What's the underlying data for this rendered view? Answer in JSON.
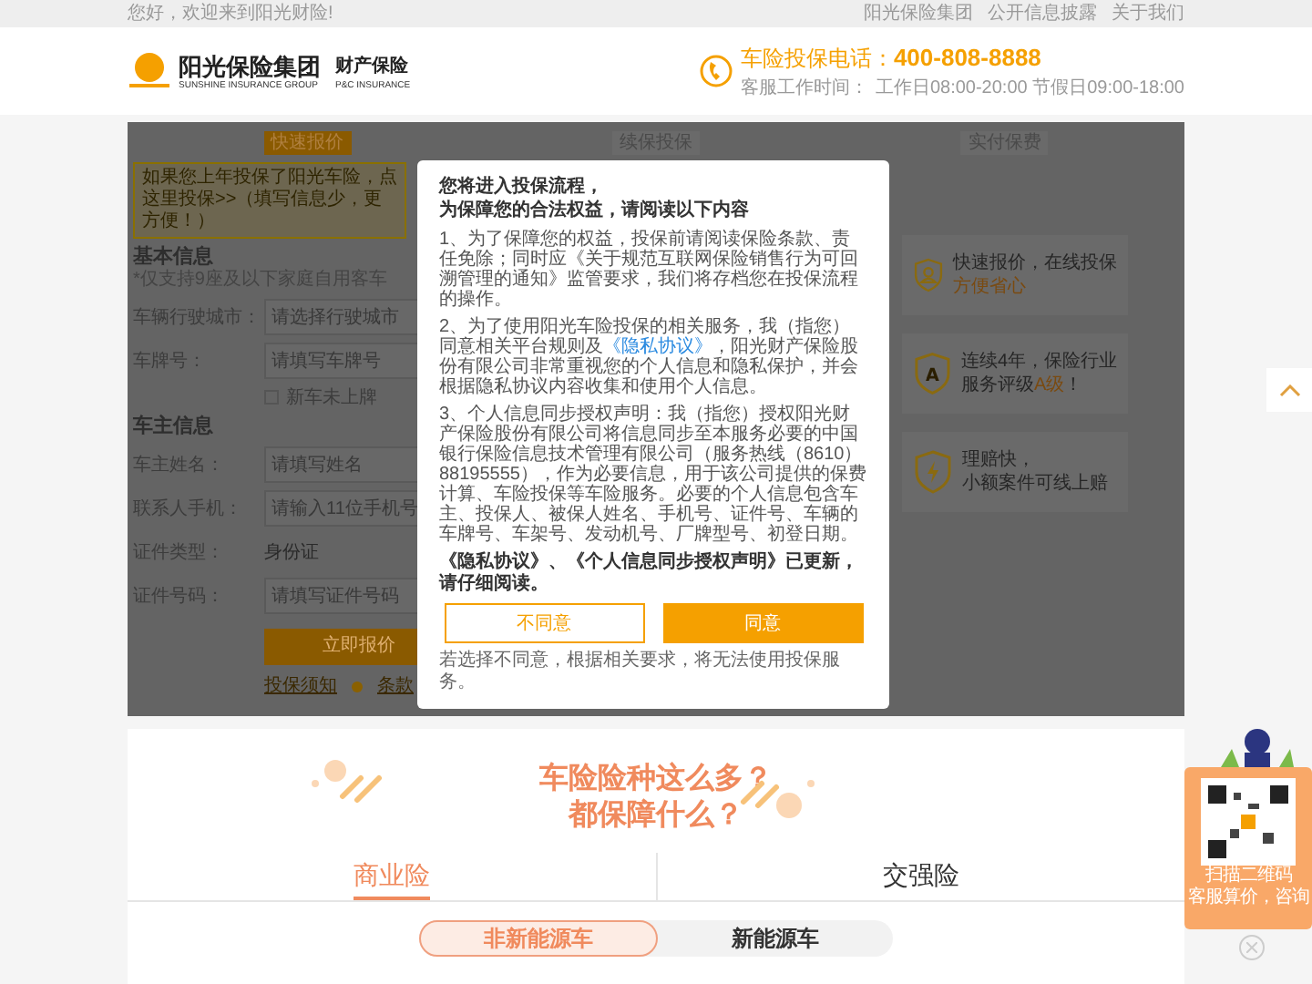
{
  "top_bar": {
    "greeting": "您好，欢迎来到阳光财险!",
    "links": [
      "阳光保险集团",
      "公开信息披露",
      "关于我们"
    ]
  },
  "header": {
    "logo": {
      "name": "阳光保险集团",
      "name_en": "SUNSHINE INSURANCE GROUP",
      "division": "财产保险",
      "division_en": "P&C INSURANCE"
    },
    "hotline": {
      "label": "车险投保电话：",
      "number": "400-808-8888",
      "hours_label": "客服工作时间：",
      "hours": "工作日08:00-20:00 节假日09:00-18:00"
    }
  },
  "tabs": [
    {
      "label": "快速报价",
      "selected": true
    },
    {
      "label": "续保投保",
      "selected": false
    },
    {
      "label": "实付保费",
      "selected": false
    }
  ],
  "notice": "如果您上年投保了阳光车险，点这里投保>>（填写信息少，更方便！）",
  "basic_info": {
    "title": "基本信息",
    "note": "*仅支持9座及以下家庭自用客车",
    "fields": [
      {
        "label": "车辆行驶城市：",
        "kind": "input",
        "placeholder": "请选择行驶城市"
      },
      {
        "label": "车牌号：",
        "kind": "input",
        "placeholder": "请填写车牌号"
      }
    ],
    "checkbox": {
      "label": "新车未上牌",
      "checked": false
    }
  },
  "owner_info": {
    "title": "车主信息",
    "fields": [
      {
        "label": "车主姓名：",
        "kind": "input",
        "placeholder": "请填写姓名"
      },
      {
        "label": "联系人手机：",
        "kind": "input",
        "placeholder": "请输入11位手机号"
      },
      {
        "label": "证件类型：",
        "kind": "select",
        "value": "身份证"
      },
      {
        "label": "证件号码：",
        "kind": "input",
        "placeholder": "请填写证件号码"
      }
    ]
  },
  "quote_button": "立即报价",
  "form_links": [
    "投保须知",
    "条款"
  ],
  "features": [
    {
      "kind": "person",
      "lines": [
        {
          "text": "快速报价，在线投保",
          "highlight": false
        },
        {
          "text": "方便省心",
          "highlight": true
        }
      ]
    },
    {
      "kind": "letter",
      "icon_text": "A",
      "lines": [
        {
          "text": "连续4年，保险行业",
          "highlight": false
        },
        {
          "text": "服务评级**A级**！",
          "highlight": false
        }
      ]
    },
    {
      "kind": "bolt",
      "lines": [
        {
          "text": "理赔快，",
          "highlight": false
        },
        {
          "text": "小额案件可线上赔",
          "highlight": false
        }
      ]
    }
  ],
  "modal": {
    "title_lines": [
      "您将进入投保流程，",
      "为保障您的合法权益，请阅读以下内容"
    ],
    "paragraphs": [
      {
        "text": "1、为了保障您的权益，投保前请阅读保险条款、责任免除；同时应《关于规范互联网保险销售行为可回溯管理的通知》监管要求，我们将存档您在投保流程的操作。"
      },
      {
        "text": "2、为了使用阳光车险投保的相关服务，我（指您）同意相关平台规则及",
        "link": "《隐私协议》",
        "after": "，阳光财产保险股份有限公司非常重视您的个人信息和隐私保护，并会根据隐私协议内容收集和使用个人信息。"
      },
      {
        "text": "3、个人信息同步授权声明：我（指您）授权阳光财产保险股份有限公司将信息同步至本服务必要的中国银行保险信息技术管理有限公司（服务热线（8610）88195555），作为必要信息，用于该公司提供的保费计算、车险投保等车险服务。必要的个人信息包含车主、投保人、被保人姓名、手机号、证件号、车辆的车牌号、车架号、发动机号、厂牌型号、初登日期。"
      }
    ],
    "update_notice": "《隐私协议》、《个人信息同步授权声明》已更新，请仔细阅读。",
    "buttons": [
      {
        "label": "不同意",
        "kind": "secondary"
      },
      {
        "label": "同意",
        "kind": "primary"
      }
    ],
    "footnote": "若选择不同意，根据相关要求，将无法使用投保服务。"
  },
  "coverage": {
    "title_lines": [
      "车险险种这么多？",
      "都保障什么？"
    ],
    "tabs": [
      {
        "label": "商业险",
        "selected": true
      },
      {
        "label": "交强险",
        "selected": false
      }
    ],
    "segments": [
      {
        "label": "非新能源车",
        "selected": true
      },
      {
        "label": "新能源车",
        "selected": false
      }
    ]
  },
  "qr_widget": {
    "lines": [
      "扫描二维码",
      "客服算价，咨询"
    ]
  }
}
